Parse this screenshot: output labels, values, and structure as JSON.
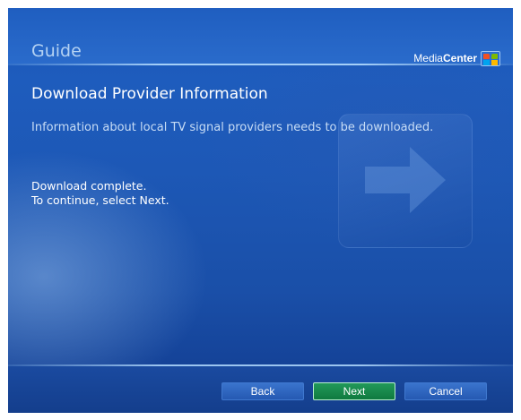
{
  "app": {
    "title": "Guide",
    "brand_prefix": "Media",
    "brand_suffix": "Center"
  },
  "main": {
    "heading": "Download Provider Information",
    "description": "Information about local TV signal providers needs to be downloaded.",
    "status_line1": "Download complete.",
    "status_line2": "To continue, select Next."
  },
  "footer": {
    "back_label": "Back",
    "next_label": "Next",
    "cancel_label": "Cancel"
  },
  "colors": {
    "accent_selected": "#0f7a3f",
    "background": "#1a56b8",
    "title_text": "#b4d2f3"
  },
  "icons": {
    "watermark": "arrow-right-icon",
    "logo": "windows-flag-icon"
  }
}
